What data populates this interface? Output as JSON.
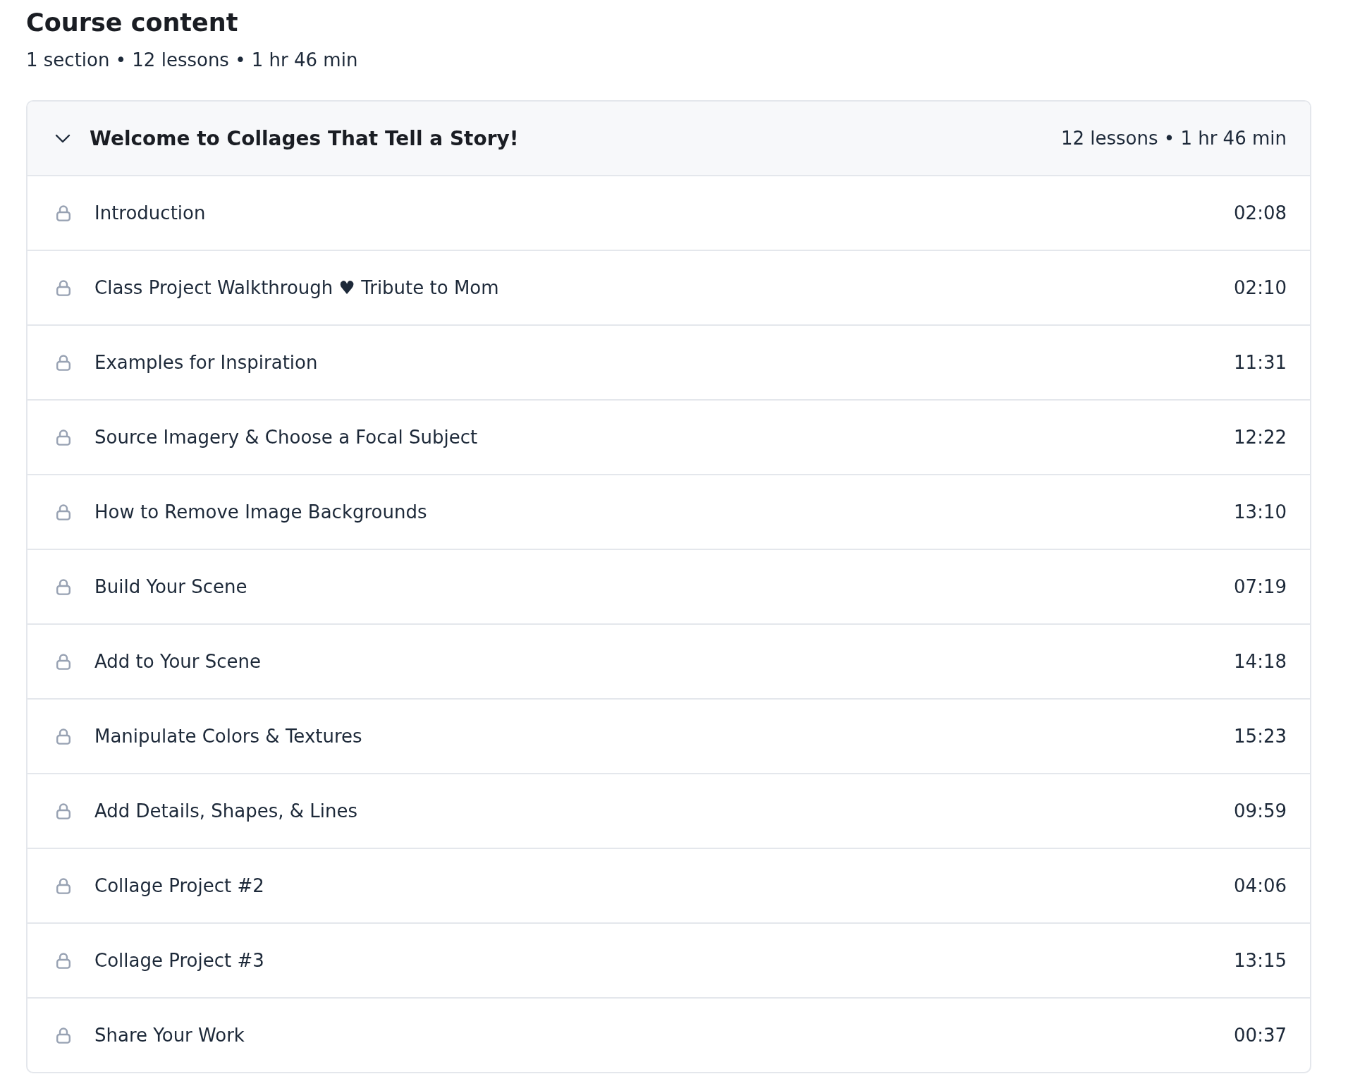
{
  "heading": {
    "title": "Course content",
    "summary": "1 section • 12 lessons • 1 hr 46 min"
  },
  "section": {
    "title": "Welcome to Collages That Tell a Story!",
    "meta": "12 lessons • 1 hr 46 min",
    "expanded": true,
    "lessons": [
      {
        "title": "Introduction",
        "duration": "02:08",
        "locked": true
      },
      {
        "title": "Class Project Walkthrough ♥ Tribute to Mom",
        "duration": "02:10",
        "locked": true
      },
      {
        "title": "Examples for Inspiration",
        "duration": "11:31",
        "locked": true
      },
      {
        "title": "Source Imagery & Choose a Focal Subject",
        "duration": "12:22",
        "locked": true
      },
      {
        "title": "How to Remove Image Backgrounds",
        "duration": "13:10",
        "locked": true
      },
      {
        "title": "Build Your Scene",
        "duration": "07:19",
        "locked": true
      },
      {
        "title": "Add to Your Scene",
        "duration": "14:18",
        "locked": true
      },
      {
        "title": "Manipulate Colors & Textures",
        "duration": "15:23",
        "locked": true
      },
      {
        "title": "Add Details, Shapes, & Lines",
        "duration": "09:59",
        "locked": true
      },
      {
        "title": "Collage Project #2",
        "duration": "04:06",
        "locked": true
      },
      {
        "title": "Collage Project #3",
        "duration": "13:15",
        "locked": true
      },
      {
        "title": "Share Your Work",
        "duration": "00:37",
        "locked": true
      }
    ]
  }
}
